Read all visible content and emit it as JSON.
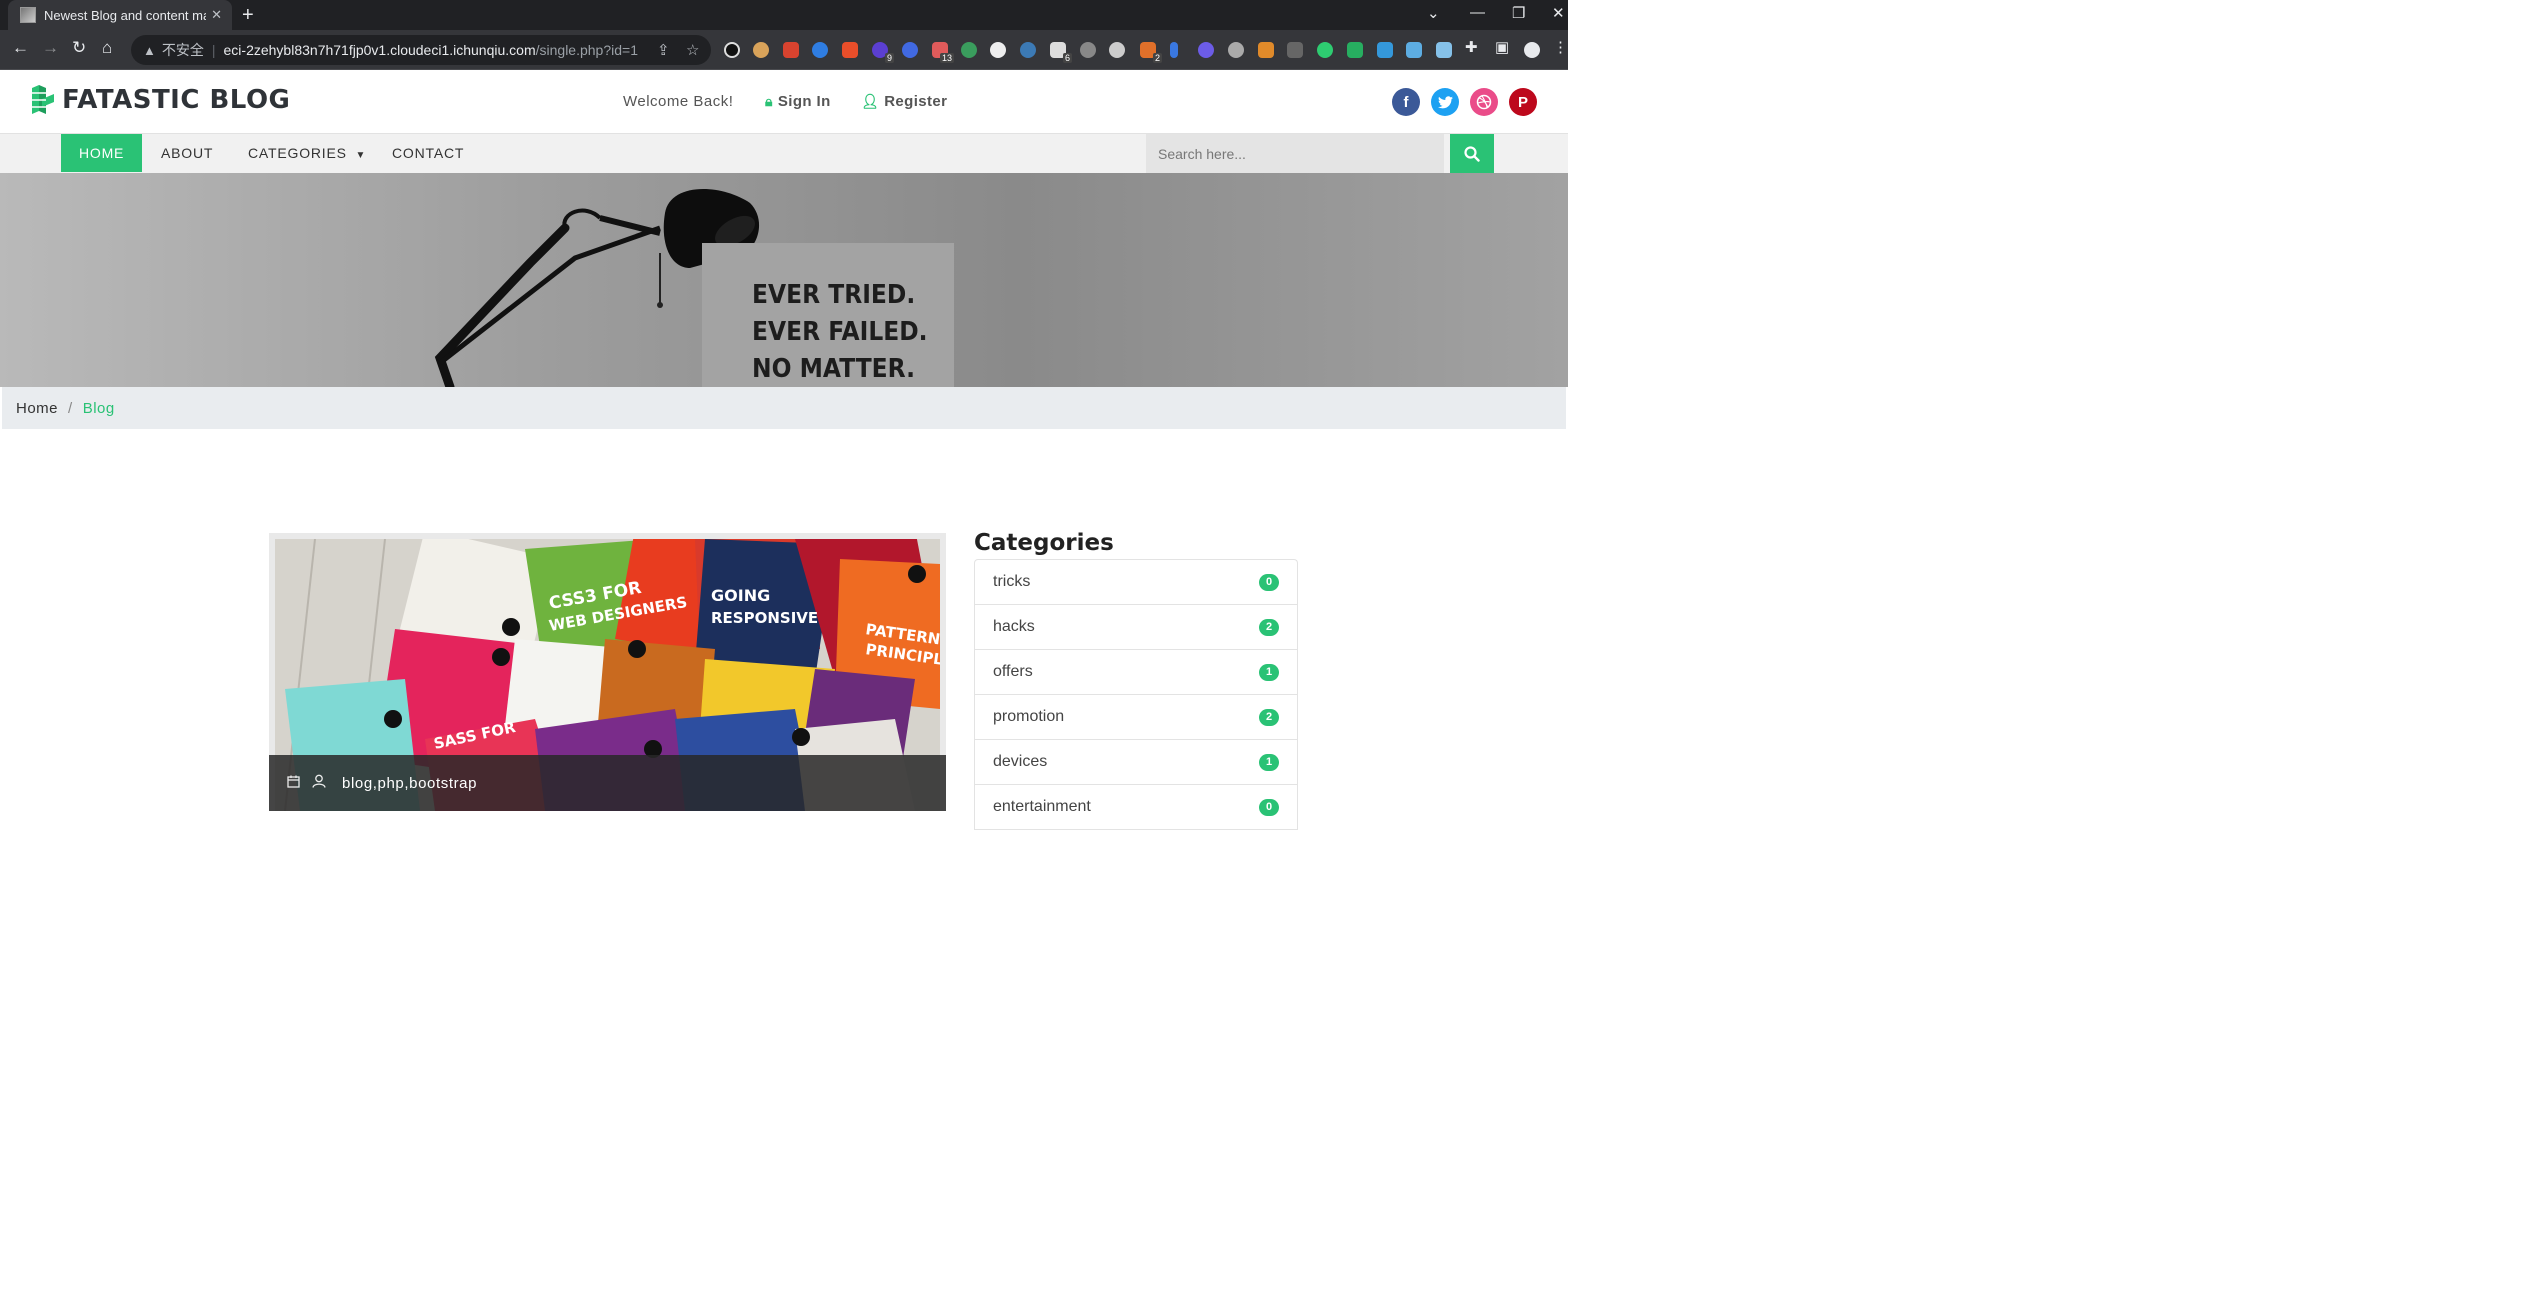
{
  "browser": {
    "tab_title": "Newest Blog and content mar",
    "url_warning": "不安全",
    "url_host": "eci-2zehybl83n7h71fjp0v1.cloudeci1.ichunqiu.com",
    "url_path": "/single.php?id=1",
    "extension_badges": [
      "9",
      "13",
      "6",
      "2"
    ]
  },
  "header": {
    "logo": "FATASTIC BLOG",
    "welcome": "Welcome Back!",
    "signin": "Sign In",
    "register": "Register",
    "social": [
      "facebook-icon",
      "twitter-icon",
      "dribbble-icon",
      "pinterest-icon"
    ]
  },
  "nav": {
    "home": "HOME",
    "about": "ABOUT",
    "categories": "CATEGORIES",
    "contact": "CONTACT",
    "search_placeholder": "Search here..."
  },
  "hero": {
    "line1": "EVER TRIED.",
    "line2": "EVER FAILED.",
    "line3": "NO MATTER."
  },
  "breadcrumb": {
    "home": "Home",
    "current": "Blog"
  },
  "post": {
    "tags": "blog,php,bootstrap"
  },
  "sidebar": {
    "title": "Categories",
    "items": [
      {
        "name": "tricks",
        "count": "0"
      },
      {
        "name": "hacks",
        "count": "2"
      },
      {
        "name": "offers",
        "count": "1"
      },
      {
        "name": "promotion",
        "count": "2"
      },
      {
        "name": "devices",
        "count": "1"
      },
      {
        "name": "entertainment",
        "count": "0"
      }
    ]
  },
  "colors": {
    "accent": "#2ac275",
    "facebook": "#3b5998",
    "twitter": "#1da1f2",
    "dribbble": "#ea4c89",
    "pinterest": "#bd081c"
  }
}
